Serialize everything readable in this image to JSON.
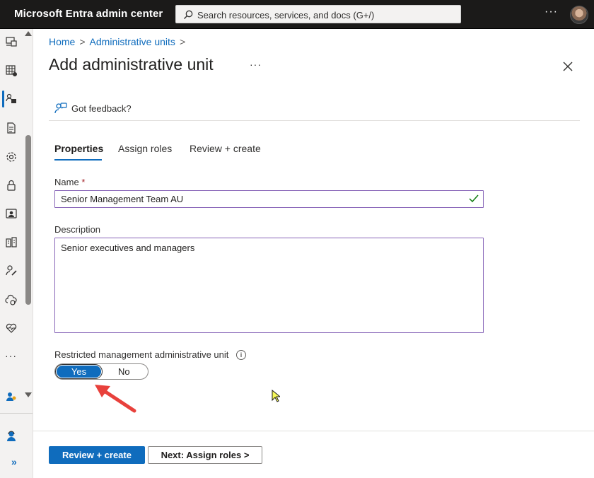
{
  "app": {
    "title": "Microsoft Entra admin center"
  },
  "search": {
    "placeholder": "Search resources, services, and docs (G+/)"
  },
  "topbar": {
    "more_label": "···"
  },
  "rail": {
    "icons": [
      "devices-icon",
      "grid-globe-icon",
      "admin-units-icon",
      "document-icon",
      "gear-icon",
      "lock-icon",
      "id-card-icon",
      "building-icon",
      "user-edit-icon",
      "cloud-sync-icon",
      "heart-monitor-icon",
      "users-icon",
      "person-support-icon"
    ],
    "more_label": "···",
    "expand_label": "»"
  },
  "breadcrumb": {
    "home": "Home",
    "parent": "Administrative units",
    "separator": ">"
  },
  "page": {
    "title": "Add administrative unit",
    "more_label": "···"
  },
  "feedback": {
    "label": "Got feedback?"
  },
  "tabs": [
    {
      "label": "Properties",
      "active": true
    },
    {
      "label": "Assign roles",
      "active": false
    },
    {
      "label": "Review + create",
      "active": false
    }
  ],
  "form": {
    "name_label": "Name",
    "name_required_mark": "*",
    "name_value": "Senior Management Team AU",
    "description_label": "Description",
    "description_value": "Senior executives and managers",
    "restricted_label": "Restricted management administrative unit",
    "info_glyph": "i",
    "toggle_yes": "Yes",
    "toggle_no": "No",
    "toggle_selected": "Yes"
  },
  "footer": {
    "primary_label": "Review + create",
    "secondary_label": "Next: Assign roles >"
  },
  "colors": {
    "accent": "#0f6cbd",
    "topbar": "#1b1a19",
    "field_border": "#8764b8",
    "annotation_arrow": "#e8413c",
    "valid_check": "#107c10"
  }
}
